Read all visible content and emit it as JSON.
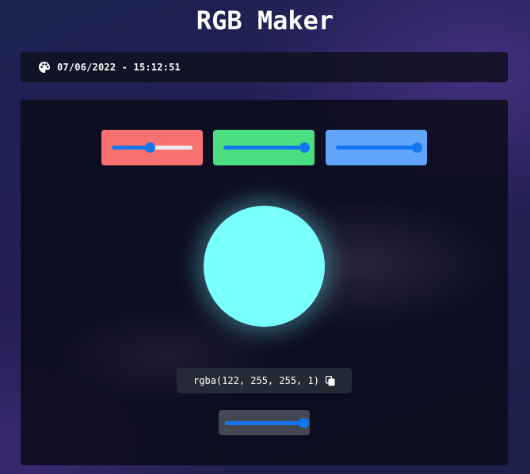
{
  "app": {
    "title": "RGB Maker"
  },
  "datebar": {
    "icon": "palette-icon",
    "datetime": "07/06/2022 - 15:12:51"
  },
  "sliders": {
    "red": {
      "value": 122,
      "min": 0,
      "max": 255,
      "box_color": "#f87171"
    },
    "green": {
      "value": 255,
      "min": 0,
      "max": 255,
      "box_color": "#4ade80"
    },
    "blue": {
      "value": 255,
      "min": 0,
      "max": 255,
      "box_color": "#60a5fa"
    },
    "alpha": {
      "value": 1,
      "min": 0,
      "max": 1,
      "box_color": "#50525c"
    }
  },
  "preview": {
    "color": "#7affff"
  },
  "output": {
    "rgba_text": "rgba(122, 255, 255, 1)",
    "copy_icon": "copy-icon"
  },
  "colors": {
    "slider_accent": "#1476ee",
    "track": "#eeeeee"
  }
}
